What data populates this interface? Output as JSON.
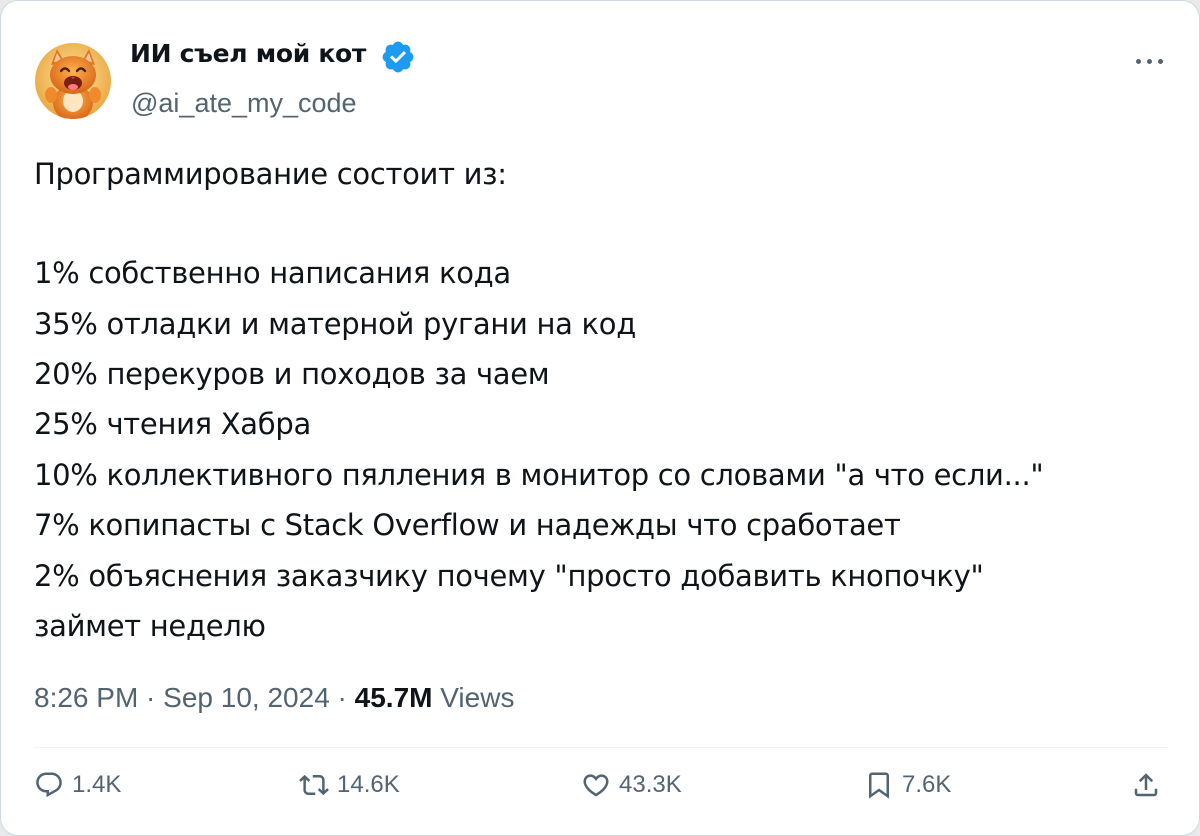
{
  "author": {
    "display_name": "ИИ съел мой кот",
    "handle": "@ai_ate_my_code",
    "verified_icon": "verified-badge-icon",
    "avatar": "orange-cat-avatar"
  },
  "tweet": {
    "lines": [
      "Программирование состоит из:",
      "1% собственно написания кода",
      "35% отладки и матерной ругани на код",
      "20% перекуров и походов за чаем",
      "25% чтения Хабра",
      "10% коллективного пялления в монитор со словами \"а что если...\"",
      "7% копипасты с Stack Overflow и надежды что сработает",
      "2% объяснения заказчику почему \"просто добавить кнопочку\"",
      "займет неделю"
    ]
  },
  "meta": {
    "time": "8:26 PM",
    "separator1": " · ",
    "date": "Sep 10, 2024",
    "separator2": " · ",
    "views_count": "45.7M",
    "views_label": " Views"
  },
  "actions": {
    "replies": "1.4K",
    "reposts": "14.6K",
    "likes": "43.3K",
    "bookmarks": "7.6K"
  },
  "colors": {
    "text": "#0f1419",
    "secondary": "#536471",
    "verified": "#1d9bf0",
    "divider": "#eff3f4"
  }
}
